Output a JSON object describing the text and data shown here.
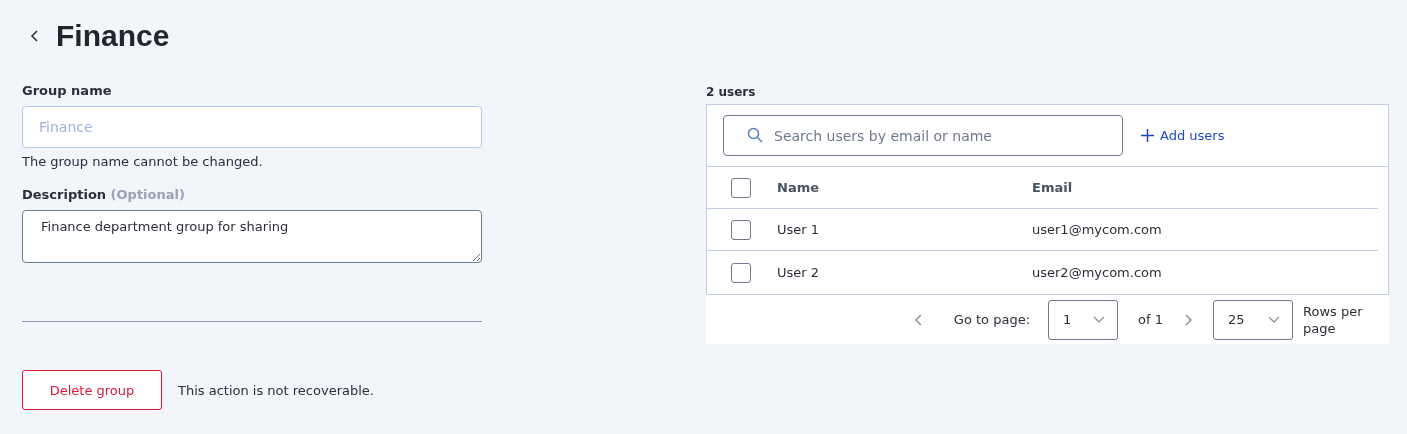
{
  "header": {
    "title": "Finance"
  },
  "form": {
    "group_name": {
      "label": "Group name",
      "value": "Finance",
      "disabled": true,
      "help": "The group name cannot be changed."
    },
    "description": {
      "label": "Description",
      "optional": "(Optional)",
      "value": "Finance department group for sharing"
    },
    "delete": {
      "button": "Delete group",
      "note": "This action is not recoverable."
    }
  },
  "users": {
    "count": "2 users",
    "search": {
      "placeholder": "Search users by email or name"
    },
    "add_button": "Add users",
    "table": {
      "columns": [
        "Name",
        "Email"
      ],
      "select_all": {
        "checked": false
      },
      "rows": [
        {
          "cells": [
            "User 1",
            "user1@mycom.com"
          ],
          "checked": false
        },
        {
          "cells": [
            "User 2",
            "user2@mycom.com"
          ],
          "checked": false
        }
      ]
    },
    "pagination": {
      "go_to_label": "Go to page:",
      "page": "1",
      "of": "of 1",
      "rows_per_page": "25",
      "rows_label": "Rows per page"
    }
  }
}
